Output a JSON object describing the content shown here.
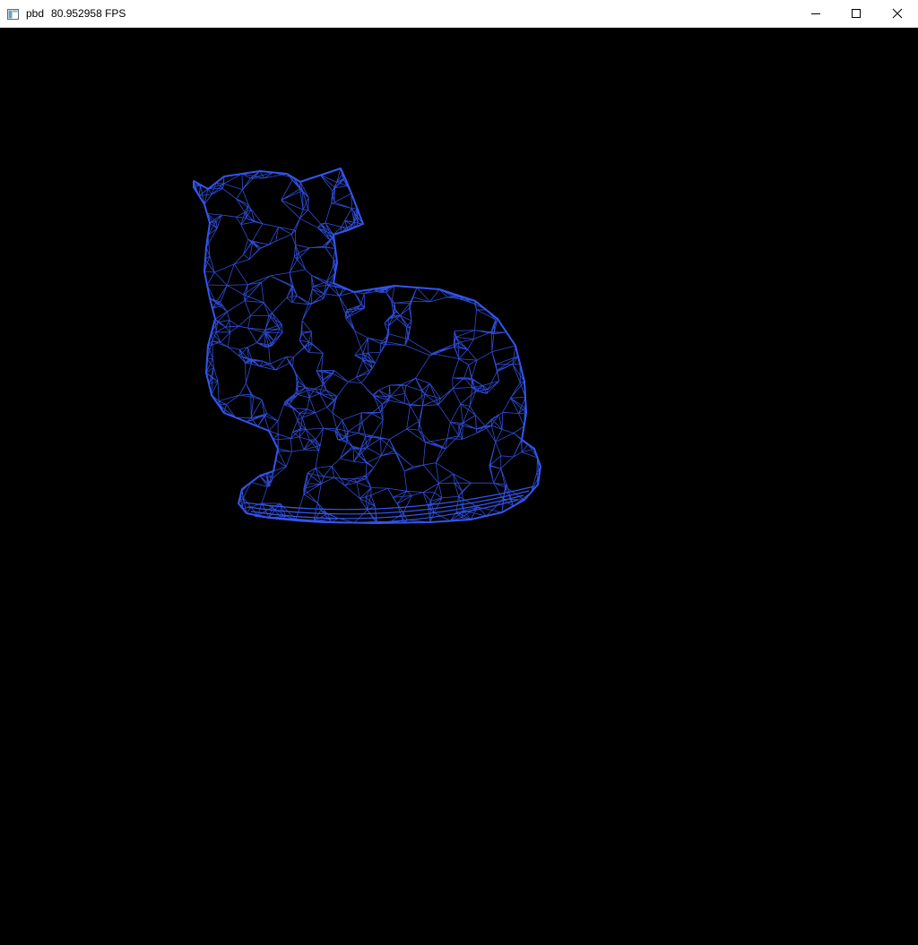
{
  "window": {
    "app_name": "pbd",
    "fps_text": "80.952958 FPS"
  },
  "titlebar": {
    "icons": {
      "app": "window-app-icon",
      "minimize": "minimize-icon",
      "maximize": "maximize-icon",
      "close": "close-icon"
    }
  },
  "viewport": {
    "background": "#000000",
    "mesh": {
      "subject": "cat",
      "render_mode": "wireframe",
      "color": "#3355ee"
    }
  }
}
